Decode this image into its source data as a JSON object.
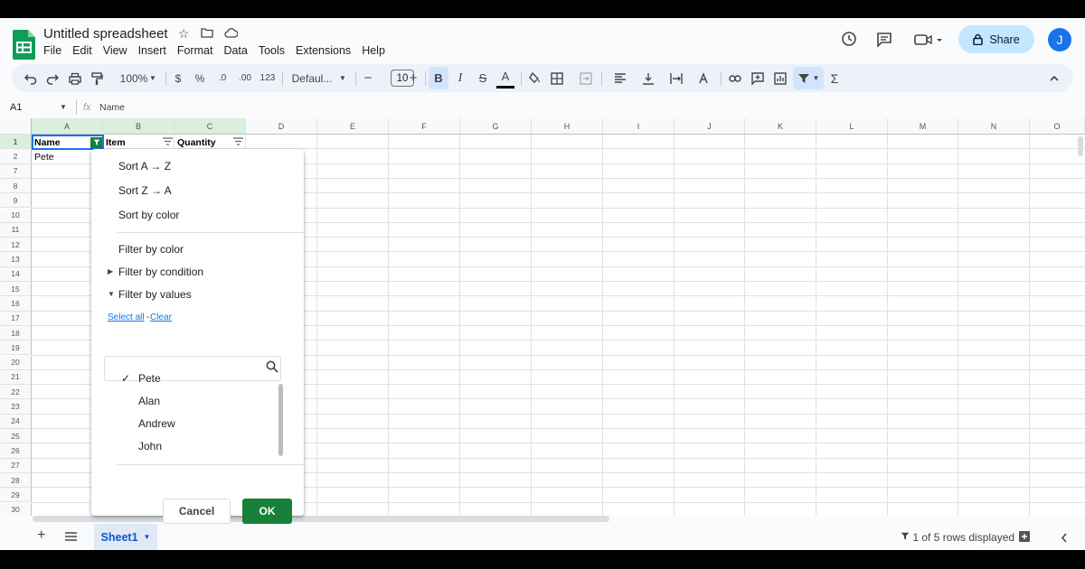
{
  "app": {
    "title": "Untitled spreadsheet",
    "menu": [
      "File",
      "Edit",
      "View",
      "Insert",
      "Format",
      "Data",
      "Tools",
      "Extensions",
      "Help"
    ],
    "share_label": "Share",
    "avatar_initial": "J",
    "brand_color": "#188038",
    "accent_color": "#1a73e8"
  },
  "toolbar": {
    "zoom": "100%",
    "currency": "$",
    "percent": "%",
    "decrease_decimal": ".0",
    "increase_decimal": ".00",
    "more_formats": "123",
    "font": "Defaul...",
    "font_size": "10",
    "bold": "B",
    "italic": "I",
    "strike": "S",
    "text_color": "A",
    "functions": "Σ"
  },
  "formula_bar": {
    "cell_ref": "A1",
    "fx": "fx",
    "content": "Name"
  },
  "grid": {
    "columns": [
      "A",
      "B",
      "C",
      "D",
      "E",
      "F",
      "G",
      "H",
      "I",
      "J",
      "K",
      "L",
      "M",
      "N",
      "O"
    ],
    "rows": [
      "1",
      "2",
      "7",
      "8",
      "9",
      "10",
      "11",
      "12",
      "13",
      "14",
      "15",
      "16",
      "17",
      "18",
      "19",
      "20",
      "21",
      "22",
      "23",
      "24",
      "25",
      "26",
      "27",
      "28",
      "29",
      "30"
    ],
    "headers": [
      "Name",
      "Item",
      "Quantity"
    ],
    "visible_data": [
      "Pete"
    ]
  },
  "filter_menu": {
    "sort_az": "Sort A → Z",
    "sort_za": "Sort Z → A",
    "sort_color": "Sort by color",
    "filter_color": "Filter by color",
    "filter_condition": "Filter by condition",
    "filter_values": "Filter by values",
    "select_all": "Select all",
    "link_sep": "-",
    "clear": "Clear",
    "values": [
      {
        "label": "Pete",
        "checked": true
      },
      {
        "label": "Alan",
        "checked": false
      },
      {
        "label": "Andrew",
        "checked": false
      },
      {
        "label": "John",
        "checked": false
      }
    ],
    "cancel": "Cancel",
    "ok": "OK"
  },
  "footer": {
    "sheet_name": "Sheet1",
    "status": "1 of 5 rows displayed"
  }
}
